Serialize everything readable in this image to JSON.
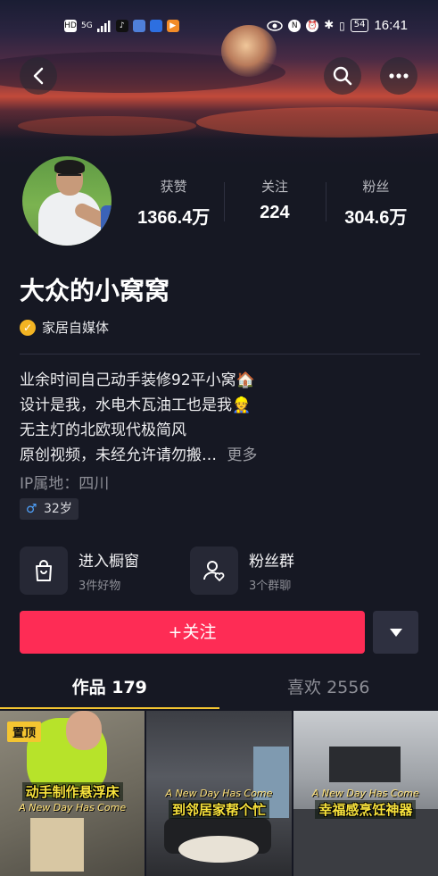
{
  "status_bar": {
    "left_icons": [
      "HD",
      "5G",
      "signal",
      "tiktok",
      "cloud",
      "location",
      "video"
    ],
    "right_icons": [
      "eye",
      "nfc",
      "alarm",
      "bluetooth",
      "vibrate"
    ],
    "battery": "54",
    "time": "16:41"
  },
  "header": {
    "back_icon": "chevron-left-icon",
    "search_icon": "search-icon",
    "more_icon": "ellipsis-icon"
  },
  "stats": [
    {
      "label": "获赞",
      "value": "1366.4万"
    },
    {
      "label": "关注",
      "value": "224"
    },
    {
      "label": "粉丝",
      "value": "304.6万"
    }
  ],
  "profile": {
    "name": "大众的小窝窝",
    "verification": "家居自媒体",
    "bio_lines": [
      "业余时间自己动手装修92平小窝🏠",
      "设计是我，水电木瓦油工也是我👷",
      "无主灯的北欧现代极简风",
      "原创视频，未经允许请勿搬…"
    ],
    "bio_more": "更多",
    "ip_location": "IP属地：四川",
    "gender_symbol": "♂",
    "age": "32岁"
  },
  "entries": [
    {
      "title": "进入橱窗",
      "sub": "3件好物"
    },
    {
      "title": "粉丝群",
      "sub": "3个群聊"
    }
  ],
  "actions": {
    "follow_label": "+关注"
  },
  "tabs": [
    {
      "label": "作品 179",
      "active": true
    },
    {
      "label": "喜欢 2556",
      "active": false
    }
  ],
  "videos": [
    {
      "pinned_label": "置顶",
      "caption": "动手制作悬浮床",
      "subcaption": "A New Day Has Come"
    },
    {
      "caption": "到邻居家帮个忙",
      "subcaption": "A New Day Has Come"
    },
    {
      "caption": "幸福感烹饪神器",
      "subcaption": "A New Day Has Come"
    }
  ],
  "colors": {
    "background": "#161823",
    "follow_button": "#fe2c55",
    "tab_indicator": "#f4c531",
    "verify_badge": "#f3b423"
  }
}
